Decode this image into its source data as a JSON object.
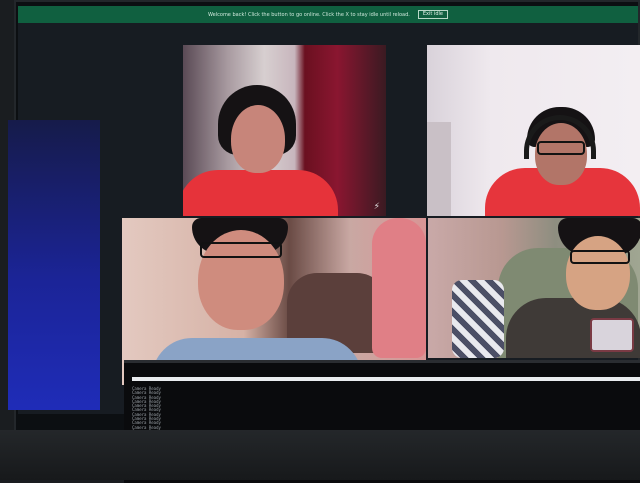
{
  "banner": {
    "message": "Welcome back! Click the button to go online. Click the X to stay idle until reload.",
    "exit_label": "Exit idle"
  },
  "participants": [
    {
      "id": "participant-1",
      "shirt": "#e6333a"
    },
    {
      "id": "participant-2",
      "shirt": "#e6353c"
    },
    {
      "id": "participant-3",
      "shirt": "#8aa3c6"
    },
    {
      "id": "participant-4",
      "shirt": "#3f3a37"
    }
  ],
  "terminal": {
    "lines": [
      "Camera Ready",
      "Camera Ready",
      "Camera Ready",
      "Camera Ready",
      "Camera Ready",
      "Camera Ready",
      "Camera Ready",
      "Camera Ready",
      "Camera Ready",
      "Camera Ready",
      "Camera Ready",
      "Camera Ready",
      "Camera Ready",
      "Camera Ready",
      "Camera Ready",
      "Camera Ready",
      "Camera Ready",
      "Camera Ready",
      "Camera Ready",
      "Camera Ready"
    ]
  },
  "colors": {
    "banner_bg": "#106040",
    "screen_glow": "#1f2cb8"
  }
}
